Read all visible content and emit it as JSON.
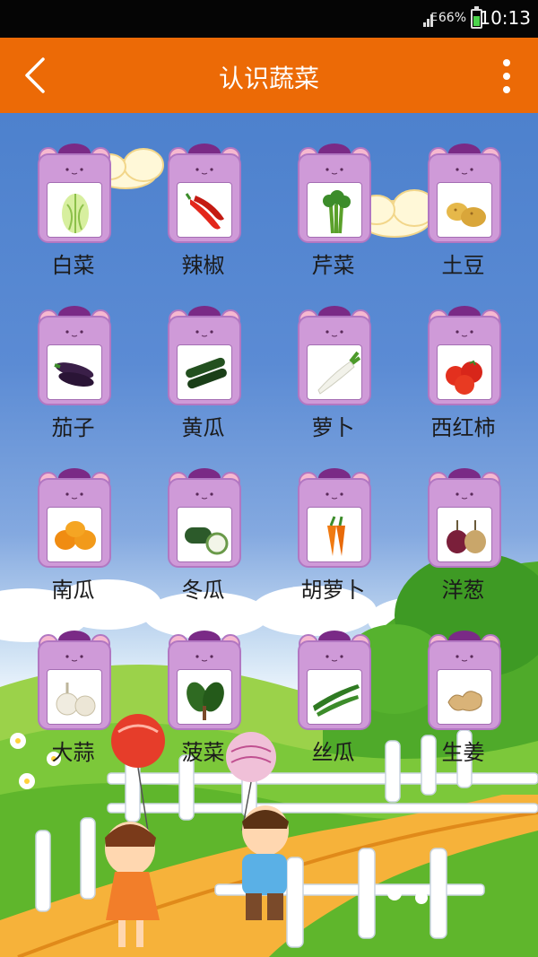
{
  "status_bar": {
    "network": "E",
    "battery": "66%",
    "time": "10:13"
  },
  "header": {
    "title": "认识蔬菜",
    "back_icon": "back-arrow-icon",
    "menu_icon": "more-vertical-icon"
  },
  "vegetables": [
    {
      "label": "白菜",
      "icon": "cabbage-icon"
    },
    {
      "label": "辣椒",
      "icon": "chili-pepper-icon"
    },
    {
      "label": "芹菜",
      "icon": "celery-icon"
    },
    {
      "label": "土豆",
      "icon": "potato-icon"
    },
    {
      "label": "茄子",
      "icon": "eggplant-icon"
    },
    {
      "label": "黄瓜",
      "icon": "cucumber-icon"
    },
    {
      "label": "萝卜",
      "icon": "radish-icon"
    },
    {
      "label": "西红柿",
      "icon": "tomato-icon"
    },
    {
      "label": "南瓜",
      "icon": "pumpkin-icon"
    },
    {
      "label": "冬瓜",
      "icon": "winter-melon-icon"
    },
    {
      "label": "胡萝卜",
      "icon": "carrot-icon"
    },
    {
      "label": "洋葱",
      "icon": "onion-icon"
    },
    {
      "label": "大蒜",
      "icon": "garlic-icon"
    },
    {
      "label": "菠菜",
      "icon": "spinach-icon"
    },
    {
      "label": "丝瓜",
      "icon": "loofah-icon"
    },
    {
      "label": "生姜",
      "icon": "ginger-icon"
    }
  ]
}
